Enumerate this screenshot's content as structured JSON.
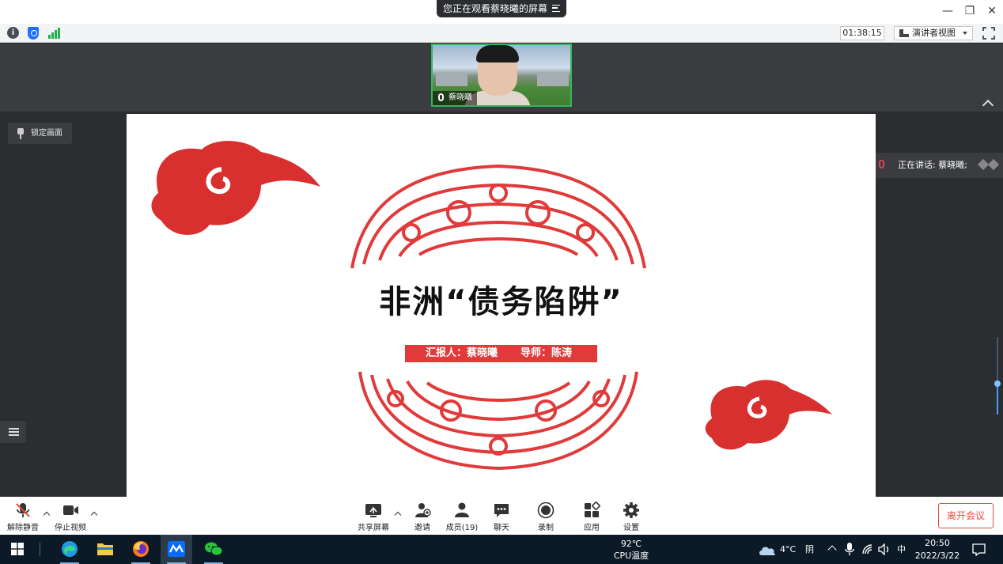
{
  "title_bar": {
    "watching_text": "您正在观看蔡晓曦的屏幕",
    "window_buttons": [
      "—",
      "❐",
      "✕"
    ]
  },
  "info_bar": {
    "timer": "01:38:15",
    "view_mode": "演讲者视图"
  },
  "video": {
    "participant_name": "蔡晓曦"
  },
  "stage": {
    "lock_view": "锁定画面",
    "speaking_now": "正在讲话: 蔡晓曦;",
    "volume_level": 0.4
  },
  "slide": {
    "title": "非洲“债务陷阱”",
    "reporter": "汇报人：蔡晓曦",
    "mentor": "导师：陈涛",
    "accent_color": "#e03a3a"
  },
  "toolbar": {
    "unmute": "解除静音",
    "stop_video": "停止视频",
    "share_screen": "共享屏幕",
    "invite": "邀请",
    "participants": "成员(19)",
    "chat": "聊天",
    "record": "录制",
    "apps": "应用",
    "settings": "设置",
    "leave": "离开会议",
    "leave_color": "#e84c3d"
  },
  "taskbar": {
    "cpu_temp": "92℃",
    "cpu_label": "CPU温度",
    "weather_temp": "4°C",
    "weather_desc": "阴",
    "ime": "中",
    "time": "20:50",
    "date": "2022/3/22"
  }
}
